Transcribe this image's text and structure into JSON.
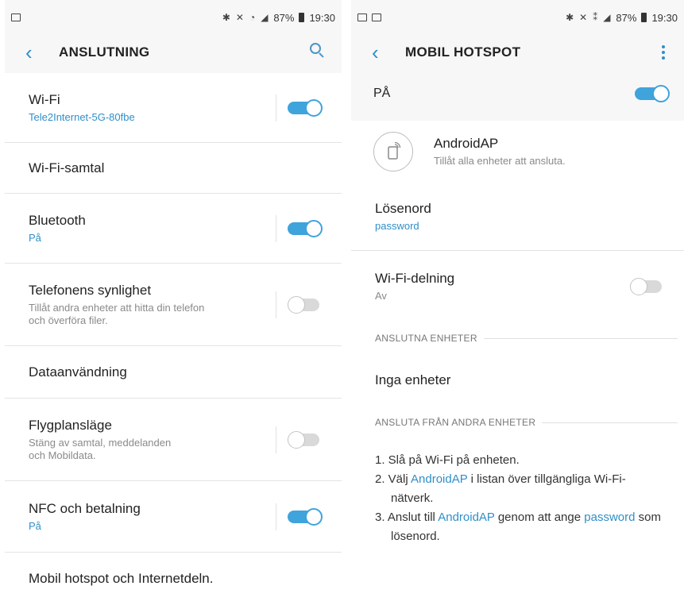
{
  "left": {
    "status": {
      "time": "19:30",
      "battery": "87%"
    },
    "header": {
      "title": "ANSLUTNING"
    },
    "items": [
      {
        "label": "Wi-Fi",
        "sub": "Tele2Internet-5G-80fbe",
        "sub_style": "blue",
        "toggle": "on"
      },
      {
        "label": "Wi-Fi-samtal"
      },
      {
        "label": "Bluetooth",
        "sub": "På",
        "sub_style": "blue",
        "toggle": "on"
      },
      {
        "label": "Telefonens synlighet",
        "sub_line1": "Tillåt andra enheter att hitta din telefon",
        "sub_line2": "och överföra filer.",
        "toggle": "off"
      },
      {
        "label": "Dataanvändning"
      },
      {
        "label": "Flygplansläge",
        "sub_line1": "Stäng av samtal, meddelanden",
        "sub_line2": "och Mobildata.",
        "toggle": "off"
      },
      {
        "label": "NFC och betalning",
        "sub": "På",
        "sub_style": "blue",
        "toggle": "on"
      },
      {
        "label": "Mobil hotspot och Internetdeln."
      }
    ]
  },
  "right": {
    "status": {
      "time": "19:30",
      "battery": "87%"
    },
    "header": {
      "title": "MOBIL HOTSPOT"
    },
    "master": {
      "label": "PÅ",
      "toggle": "on"
    },
    "network": {
      "name": "AndroidAP",
      "sub": "Tillåt alla enheter att ansluta."
    },
    "password": {
      "label": "Lösenord",
      "value": "password"
    },
    "wifi_sharing": {
      "label": "Wi-Fi-delning",
      "sub": "Av",
      "toggle": "off"
    },
    "connected": {
      "header": "ANSLUTNA ENHETER",
      "empty": "Inga enheter"
    },
    "connect_other": {
      "header": "ANSLUTA FRÅN ANDRA ENHETER",
      "step1": "1. Slå på Wi-Fi på enheten.",
      "step2_a": "2. Välj ",
      "step2_hl": "AndroidAP",
      "step2_b": " i listan över tillgängliga Wi-Fi-nätverk.",
      "step3_a": "3. Anslut till ",
      "step3_hl": "AndroidAP",
      "step3_b": " genom att ange ",
      "step3_hl2": "password",
      "step3_c": " som lösenord."
    }
  },
  "colors": {
    "accent": "#3fa3dc",
    "background": "#f7f7f7",
    "toggle_off": "#d9d9d9"
  },
  "icons": [
    "back-icon",
    "search-icon",
    "more-options-icon",
    "hotspot-device-icon",
    "bluetooth-icon",
    "mute-icon",
    "wifi-icon",
    "signal-icon",
    "battery-icon",
    "image-notification-icon"
  ]
}
